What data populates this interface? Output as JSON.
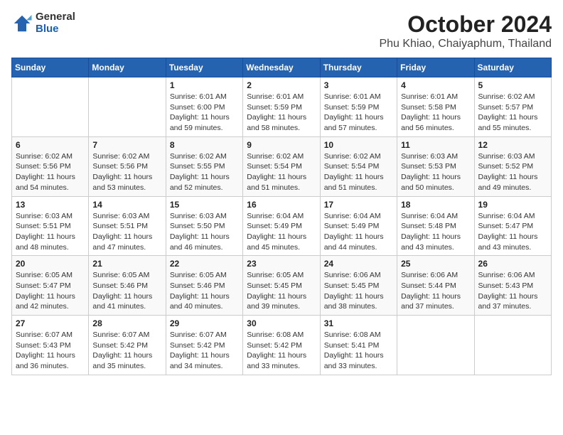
{
  "logo": {
    "general": "General",
    "blue": "Blue"
  },
  "title": "October 2024",
  "location": "Phu Khiao, Chaiyaphum, Thailand",
  "days_of_week": [
    "Sunday",
    "Monday",
    "Tuesday",
    "Wednesday",
    "Thursday",
    "Friday",
    "Saturday"
  ],
  "weeks": [
    [
      {
        "day": "",
        "info": ""
      },
      {
        "day": "",
        "info": ""
      },
      {
        "day": "1",
        "sunrise": "6:01 AM",
        "sunset": "6:00 PM",
        "daylight": "11 hours and 59 minutes."
      },
      {
        "day": "2",
        "sunrise": "6:01 AM",
        "sunset": "5:59 PM",
        "daylight": "11 hours and 58 minutes."
      },
      {
        "day": "3",
        "sunrise": "6:01 AM",
        "sunset": "5:59 PM",
        "daylight": "11 hours and 57 minutes."
      },
      {
        "day": "4",
        "sunrise": "6:01 AM",
        "sunset": "5:58 PM",
        "daylight": "11 hours and 56 minutes."
      },
      {
        "day": "5",
        "sunrise": "6:02 AM",
        "sunset": "5:57 PM",
        "daylight": "11 hours and 55 minutes."
      }
    ],
    [
      {
        "day": "6",
        "sunrise": "6:02 AM",
        "sunset": "5:56 PM",
        "daylight": "11 hours and 54 minutes."
      },
      {
        "day": "7",
        "sunrise": "6:02 AM",
        "sunset": "5:56 PM",
        "daylight": "11 hours and 53 minutes."
      },
      {
        "day": "8",
        "sunrise": "6:02 AM",
        "sunset": "5:55 PM",
        "daylight": "11 hours and 52 minutes."
      },
      {
        "day": "9",
        "sunrise": "6:02 AM",
        "sunset": "5:54 PM",
        "daylight": "11 hours and 51 minutes."
      },
      {
        "day": "10",
        "sunrise": "6:02 AM",
        "sunset": "5:54 PM",
        "daylight": "11 hours and 51 minutes."
      },
      {
        "day": "11",
        "sunrise": "6:03 AM",
        "sunset": "5:53 PM",
        "daylight": "11 hours and 50 minutes."
      },
      {
        "day": "12",
        "sunrise": "6:03 AM",
        "sunset": "5:52 PM",
        "daylight": "11 hours and 49 minutes."
      }
    ],
    [
      {
        "day": "13",
        "sunrise": "6:03 AM",
        "sunset": "5:51 PM",
        "daylight": "11 hours and 48 minutes."
      },
      {
        "day": "14",
        "sunrise": "6:03 AM",
        "sunset": "5:51 PM",
        "daylight": "11 hours and 47 minutes."
      },
      {
        "day": "15",
        "sunrise": "6:03 AM",
        "sunset": "5:50 PM",
        "daylight": "11 hours and 46 minutes."
      },
      {
        "day": "16",
        "sunrise": "6:04 AM",
        "sunset": "5:49 PM",
        "daylight": "11 hours and 45 minutes."
      },
      {
        "day": "17",
        "sunrise": "6:04 AM",
        "sunset": "5:49 PM",
        "daylight": "11 hours and 44 minutes."
      },
      {
        "day": "18",
        "sunrise": "6:04 AM",
        "sunset": "5:48 PM",
        "daylight": "11 hours and 43 minutes."
      },
      {
        "day": "19",
        "sunrise": "6:04 AM",
        "sunset": "5:47 PM",
        "daylight": "11 hours and 43 minutes."
      }
    ],
    [
      {
        "day": "20",
        "sunrise": "6:05 AM",
        "sunset": "5:47 PM",
        "daylight": "11 hours and 42 minutes."
      },
      {
        "day": "21",
        "sunrise": "6:05 AM",
        "sunset": "5:46 PM",
        "daylight": "11 hours and 41 minutes."
      },
      {
        "day": "22",
        "sunrise": "6:05 AM",
        "sunset": "5:46 PM",
        "daylight": "11 hours and 40 minutes."
      },
      {
        "day": "23",
        "sunrise": "6:05 AM",
        "sunset": "5:45 PM",
        "daylight": "11 hours and 39 minutes."
      },
      {
        "day": "24",
        "sunrise": "6:06 AM",
        "sunset": "5:45 PM",
        "daylight": "11 hours and 38 minutes."
      },
      {
        "day": "25",
        "sunrise": "6:06 AM",
        "sunset": "5:44 PM",
        "daylight": "11 hours and 37 minutes."
      },
      {
        "day": "26",
        "sunrise": "6:06 AM",
        "sunset": "5:43 PM",
        "daylight": "11 hours and 37 minutes."
      }
    ],
    [
      {
        "day": "27",
        "sunrise": "6:07 AM",
        "sunset": "5:43 PM",
        "daylight": "11 hours and 36 minutes."
      },
      {
        "day": "28",
        "sunrise": "6:07 AM",
        "sunset": "5:42 PM",
        "daylight": "11 hours and 35 minutes."
      },
      {
        "day": "29",
        "sunrise": "6:07 AM",
        "sunset": "5:42 PM",
        "daylight": "11 hours and 34 minutes."
      },
      {
        "day": "30",
        "sunrise": "6:08 AM",
        "sunset": "5:42 PM",
        "daylight": "11 hours and 33 minutes."
      },
      {
        "day": "31",
        "sunrise": "6:08 AM",
        "sunset": "5:41 PM",
        "daylight": "11 hours and 33 minutes."
      },
      {
        "day": "",
        "info": ""
      },
      {
        "day": "",
        "info": ""
      }
    ]
  ]
}
